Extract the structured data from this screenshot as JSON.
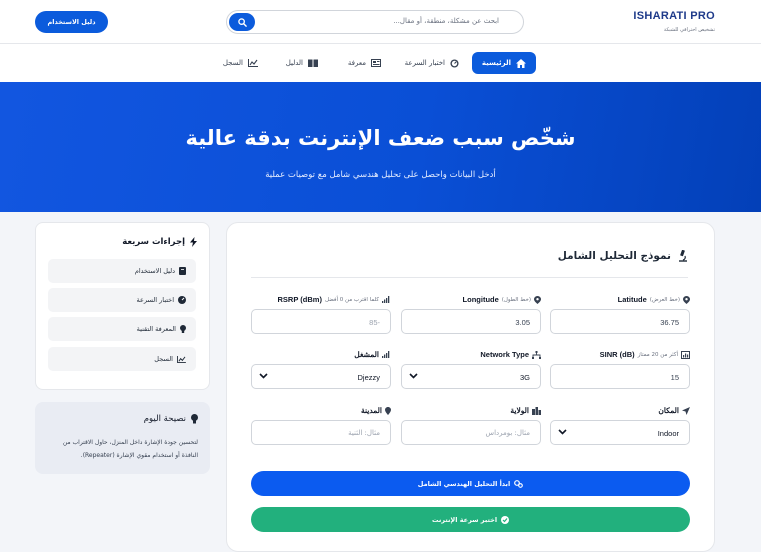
{
  "brand": {
    "name": "ISHARATI PRO",
    "tagline": "تشخيص احترافي للشبكة"
  },
  "search": {
    "placeholder": "ابحث عن مشكلة، منطقة، أو مقال..."
  },
  "header": {
    "guide_button": "دليل الاستخدام"
  },
  "nav": {
    "items": [
      {
        "label": "الرئيسية",
        "icon": "home-icon",
        "active": true
      },
      {
        "label": "اختبار السرعة",
        "icon": "speedometer-icon"
      },
      {
        "label": "معرفة",
        "icon": "newspaper-icon"
      },
      {
        "label": "الدليل",
        "icon": "book-icon"
      },
      {
        "label": "السجل",
        "icon": "chart-line-icon"
      }
    ]
  },
  "hero": {
    "title": "شخّص سبب ضعف الإنترنت بدقة عالية",
    "subtitle": "أدخل البيانات واحصل على تحليل هندسي شامل مع توصيات عملية"
  },
  "form": {
    "title": "نموذج التحليل الشامل",
    "fields": {
      "latitude": {
        "label": "Latitude",
        "hint": "(خط العرض)",
        "value": "36.75"
      },
      "longitude": {
        "label": "Longitude",
        "hint": "(خط الطول)",
        "value": "3.05"
      },
      "rsrp": {
        "label": "RSRP (dBm)",
        "hint": "كلما اقترب من 0 أفضل",
        "value": "-85"
      },
      "sinr": {
        "label": "SINR (dB)",
        "hint": "أكثر من 20 ممتاز",
        "value": "15"
      },
      "network_type": {
        "label": "Network Type",
        "value": "3G"
      },
      "operator": {
        "label": "المشغل",
        "value": "Djezzy"
      },
      "location": {
        "label": "المكان",
        "value": "Indoor"
      },
      "state": {
        "label": "الولاية",
        "placeholder": "مثال: بومرداس"
      },
      "city": {
        "label": "المدينة",
        "placeholder": "مثال: الثنية"
      }
    },
    "analyze_button": "ابدأ التحليل الهندسي الشامل",
    "speedtest_button": "اختبر سرعة الإنترنت"
  },
  "quick_actions": {
    "title": "إجراءات سريعة",
    "items": [
      {
        "label": "دليل الاستخدام",
        "icon": "book-icon"
      },
      {
        "label": "اختبار السرعة",
        "icon": "speedometer-icon"
      },
      {
        "label": "المعرفة التقنية",
        "icon": "lightbulb-icon"
      },
      {
        "label": "السجل",
        "icon": "chart-line-icon"
      }
    ]
  },
  "tip": {
    "title": "نصيحة اليوم",
    "text": "لتحسين جودة الإشارة داخل المنزل، حاول الاقتراب من النافذة أو استخدام مقوي الإشارة (Repeater)."
  },
  "colors": {
    "primary": "#0b5bdc",
    "success": "#22b07d",
    "hero_start": "#1256e0",
    "hero_end": "#0340b8",
    "brand_text": "#1e3a8a"
  }
}
